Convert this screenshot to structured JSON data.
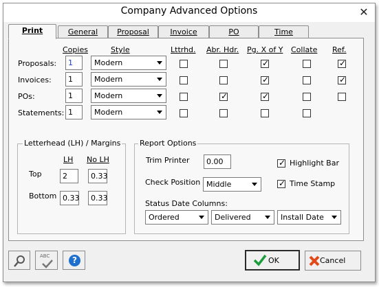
{
  "dialog": {
    "title": "Company Advanced Options",
    "close_glyph": "✕"
  },
  "tabs": [
    "Print",
    "General",
    "Proposal",
    "Invoice",
    "PO",
    "Time"
  ],
  "columns": {
    "copies": "Copies",
    "style": "Style",
    "lttrhd": "Lttrhd.",
    "abr_hdr": "Abr. Hdr.",
    "pgx": "Pg. X of Y",
    "collate": "Collate",
    "ref": "Ref."
  },
  "rows": [
    {
      "label": "Proposals:",
      "copies": "1",
      "style": "Modern",
      "lttrhd": false,
      "abr_hdr": false,
      "pgx": true,
      "collate": false,
      "ref": true
    },
    {
      "label": "Invoices:",
      "copies": "1",
      "style": "Modern",
      "lttrhd": false,
      "abr_hdr": false,
      "pgx": true,
      "collate": false,
      "ref": true
    },
    {
      "label": "POs:",
      "copies": "1",
      "style": "Modern",
      "lttrhd": false,
      "abr_hdr": true,
      "pgx": true,
      "collate": false,
      "ref": false
    },
    {
      "label": "Statements:",
      "copies": "1",
      "style": "Modern",
      "lttrhd": false,
      "abr_hdr": false,
      "pgx": false,
      "collate": false
    }
  ],
  "letterhead": {
    "title": "Letterhead (LH) / Margins",
    "lh_label": "LH",
    "nolh_label": "No LH",
    "top_label": "Top",
    "bottom_label": "Bottom",
    "top_lh": "2",
    "top_nolh": "0.33",
    "bottom_lh": "0.33",
    "bottom_nolh": "0.33"
  },
  "report": {
    "title": "Report Options",
    "trim_label": "Trim Printer",
    "trim_value": "0.00",
    "check_label": "Check Position",
    "check_value": "Middle",
    "highlight_label": "Highlight Bar",
    "highlight_checked": true,
    "timestamp_label": "Time Stamp",
    "timestamp_checked": true,
    "status_label": "Status Date Columns:",
    "status_values": [
      "Ordered",
      "Delivered",
      "Install Date"
    ]
  },
  "buttons": {
    "ok": "OK",
    "cancel": "Cancel",
    "spell_glyph": "ABC",
    "help_glyph": "?"
  },
  "colors": {
    "ok_check": "#1a9c3a",
    "cancel_x": "#e04a1a",
    "help_blue": "#1e6fd0",
    "copies_text": "#1a3cc8"
  }
}
